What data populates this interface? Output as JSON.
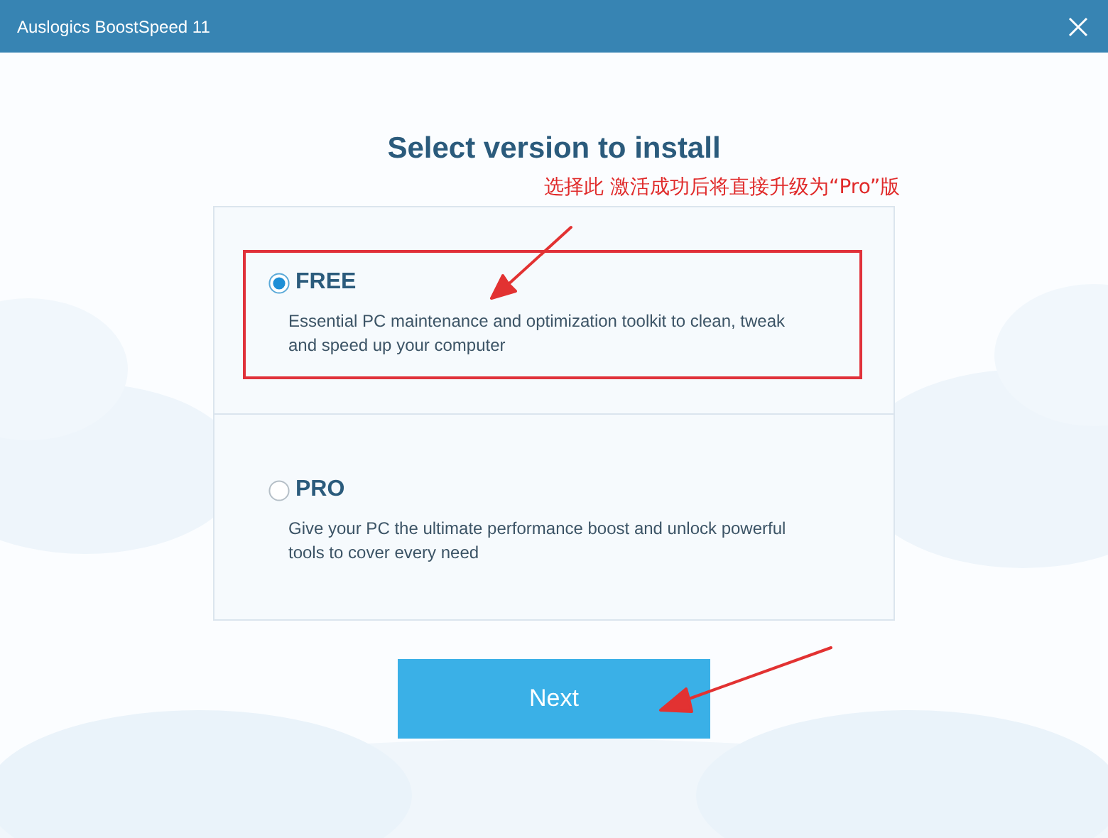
{
  "window": {
    "title": "Auslogics BoostSpeed 11"
  },
  "heading": "Select version to install",
  "annotation": {
    "text": "选择此 激活成功后将直接升级为“Pro”版"
  },
  "options": [
    {
      "name": "FREE",
      "description": "Essential PC maintenance and optimization toolkit to clean, tweak and speed up your computer",
      "selected": true,
      "highlighted": true
    },
    {
      "name": "PRO",
      "description": "Give your PC the ultimate performance boost and unlock powerful tools to cover every need",
      "selected": false,
      "highlighted": false
    }
  ],
  "button": {
    "label": "Next"
  }
}
